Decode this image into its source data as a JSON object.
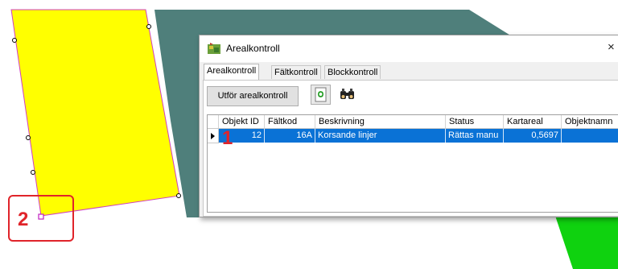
{
  "window": {
    "title": "Arealkontroll",
    "close_glyph": "×",
    "app_icon": "map-app-icon"
  },
  "tabs": [
    {
      "label": "Arealkontroll",
      "active": true
    },
    {
      "label": "Fältkontroll",
      "active": false
    },
    {
      "label": "Blockkontroll",
      "active": false
    }
  ],
  "toolbar": {
    "run_label": "Utför arealkontroll",
    "refresh_icon": "refresh-icon",
    "search_icon": "binoculars-icon"
  },
  "grid": {
    "columns": [
      "Objekt ID",
      "Fältkod",
      "Beskrivning",
      "Status",
      "Kartareal",
      "Objektnamn"
    ],
    "rows": [
      {
        "objekt_id": "12",
        "faltkod": "16A",
        "beskrivning": "Korsande linjer",
        "status": "Rättas manu",
        "kartareal": "0,5697",
        "objektnamn": ""
      }
    ]
  },
  "annotations": {
    "marker_1": "1",
    "marker_2": "2"
  },
  "colors": {
    "field_fill": "#ffff00",
    "field_border": "#d040c0",
    "teal_area": "#4f7f7b",
    "green_area": "#0fd20f",
    "selection": "#0a72d6",
    "annotation": "#e0242a"
  }
}
